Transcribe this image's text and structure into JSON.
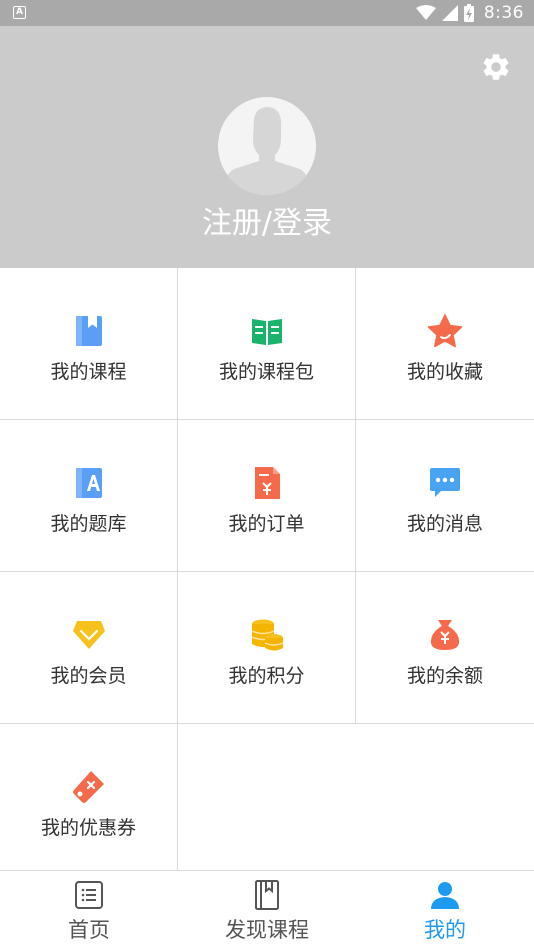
{
  "status_bar": {
    "app_badge": "A",
    "time": "8:36"
  },
  "header": {
    "login_label": "注册/登录",
    "icons": [
      "gear-icon",
      "avatar-placeholder"
    ]
  },
  "grid": {
    "items": [
      {
        "label": "我的课程",
        "icon": "course-book-icon",
        "color": "#5b9ef5"
      },
      {
        "label": "我的课程包",
        "icon": "open-book-icon",
        "color": "#19b36b"
      },
      {
        "label": "我的收藏",
        "icon": "star-icon",
        "color": "#f56a4a"
      },
      {
        "label": "我的题库",
        "icon": "question-bank-icon",
        "color": "#5b9ef5"
      },
      {
        "label": "我的订单",
        "icon": "order-icon",
        "color": "#f56a4a"
      },
      {
        "label": "我的消息",
        "icon": "message-icon",
        "color": "#4aa3f0"
      },
      {
        "label": "我的会员",
        "icon": "vip-diamond-icon",
        "color": "#f7c11c"
      },
      {
        "label": "我的积分",
        "icon": "coins-icon",
        "color": "#f7c11c"
      },
      {
        "label": "我的余额",
        "icon": "money-bag-icon",
        "color": "#f56a4a"
      },
      {
        "label": "我的优惠券",
        "icon": "coupon-tag-icon",
        "color": "#f56a4a"
      }
    ]
  },
  "tabbar": {
    "tabs": [
      {
        "label": "首页",
        "icon": "home-list-icon",
        "active": false
      },
      {
        "label": "发现课程",
        "icon": "discover-book-icon",
        "active": false
      },
      {
        "label": "我的",
        "icon": "profile-icon",
        "active": true
      }
    ],
    "active_color": "#1e9bf0",
    "inactive_color": "#555555"
  }
}
